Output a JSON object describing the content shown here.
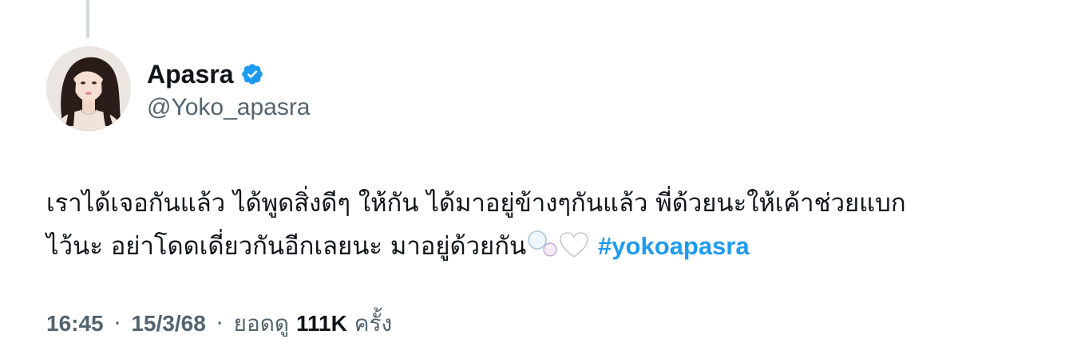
{
  "author": {
    "display_name": "Apasra",
    "handle": "@Yoko_apasra",
    "verified": true,
    "avatar_icon": "profile-photo"
  },
  "tweet": {
    "line1": "เราได้เจอกันแล้ว ได้พูดสิ่งดีๆ ให้กัน ได้มาอยู่ข้างๆกันแล้ว พี่ด้วยนะให้เค้าช่วยแบก",
    "line2": "ไว้นะ อย่าโดดเดี่ยวกันอีกเลยนะ มาอยู่ด้วยกัน",
    "emojis": [
      "bubbles-icon",
      "white-heart-icon"
    ],
    "hashtag": "#yokoapasra"
  },
  "meta": {
    "time": "16:45",
    "date": "15/3/68",
    "views_label": "ยอดดู",
    "views_count": "111K",
    "views_suffix": "ครั้ง",
    "separator": "·"
  },
  "colors": {
    "accent": "#1d9bf0",
    "secondary_text": "#536471",
    "primary_text": "#0f1419"
  }
}
